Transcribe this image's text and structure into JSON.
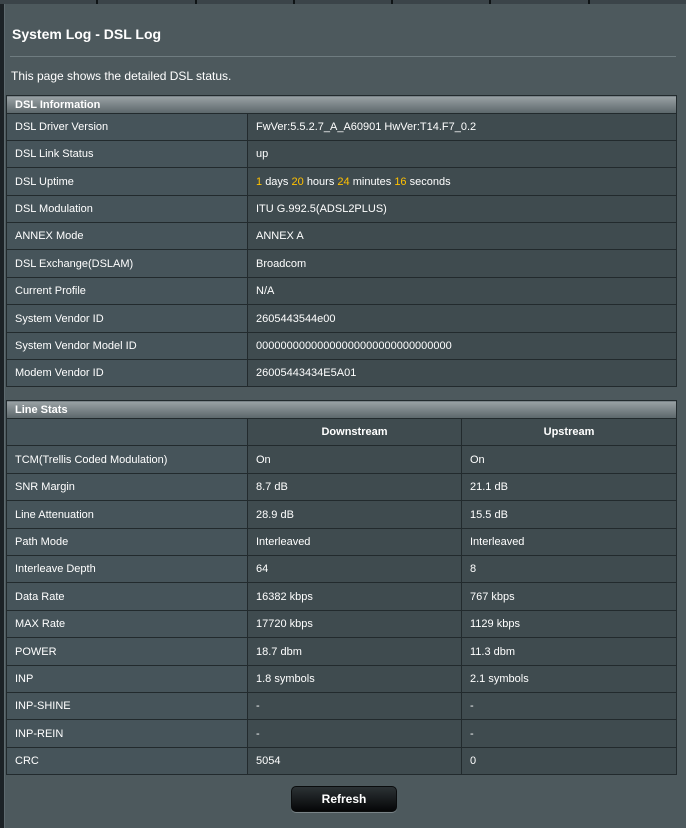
{
  "header": {
    "title": "System Log - DSL Log",
    "description": "This page shows the detailed DSL status."
  },
  "dsl_info": {
    "title": "DSL Information",
    "rows": [
      {
        "label": "DSL Driver Version",
        "value": "FwVer:5.5.2.7_A_A60901 HwVer:T14.F7_0.2"
      },
      {
        "label": "DSL Link Status",
        "value": "up"
      },
      {
        "label": "DSL Uptime",
        "value": ""
      },
      {
        "label": "DSL Modulation",
        "value": "ITU G.992.5(ADSL2PLUS)"
      },
      {
        "label": "ANNEX Mode",
        "value": "ANNEX A"
      },
      {
        "label": "DSL Exchange(DSLAM)",
        "value": "Broadcom"
      },
      {
        "label": "Current Profile",
        "value": "N/A"
      },
      {
        "label": "System Vendor ID",
        "value": "2605443544e00"
      },
      {
        "label": "System Vendor Model ID",
        "value": "00000000000000000000000000000000"
      },
      {
        "label": "Modem Vendor ID",
        "value": "26005443434E5A01"
      }
    ],
    "uptime": {
      "days": "1",
      "days_unit": "days",
      "hours": "20",
      "hours_unit": "hours",
      "minutes": "24",
      "minutes_unit": "minutes",
      "seconds": "16",
      "seconds_unit": "seconds"
    }
  },
  "line_stats": {
    "title": "Line Stats",
    "col_downstream": "Downstream",
    "col_upstream": "Upstream",
    "rows": [
      {
        "label": "TCM(Trellis Coded Modulation)",
        "down": "On",
        "up": "On"
      },
      {
        "label": "SNR Margin",
        "down": "8.7 dB",
        "up": "21.1 dB"
      },
      {
        "label": "Line Attenuation",
        "down": "28.9 dB",
        "up": "15.5 dB"
      },
      {
        "label": "Path Mode",
        "down": "Interleaved",
        "up": "Interleaved"
      },
      {
        "label": "Interleave Depth",
        "down": "64",
        "up": "8"
      },
      {
        "label": "Data Rate",
        "down": "16382 kbps",
        "up": "767 kbps"
      },
      {
        "label": "MAX Rate",
        "down": "17720 kbps",
        "up": "1129 kbps"
      },
      {
        "label": "POWER",
        "down": "18.7 dbm",
        "up": "11.3 dbm"
      },
      {
        "label": "INP",
        "down": "1.8 symbols",
        "up": "2.1 symbols"
      },
      {
        "label": "INP-SHINE",
        "down": "-",
        "up": "-"
      },
      {
        "label": "INP-REIN",
        "down": "-",
        "up": "-"
      },
      {
        "label": "CRC",
        "down": "5054",
        "up": "0"
      }
    ]
  },
  "buttons": {
    "refresh": "Refresh"
  }
}
